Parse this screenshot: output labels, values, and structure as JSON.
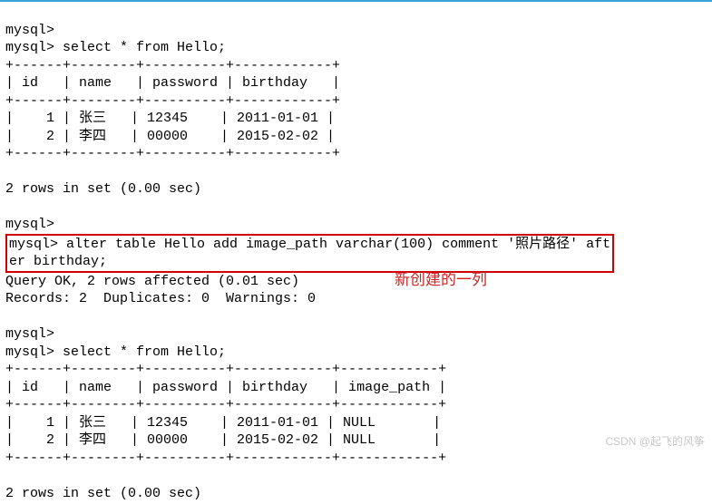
{
  "prompt": "mysql>",
  "query1": "select * from Hello;",
  "table1": {
    "border_top": "+------+--------+----------+------------+",
    "header": "| id   | name   | password | birthday   |",
    "border_mid": "+------+--------+----------+------------+",
    "rows": [
      "|    1 | 张三   | 12345    | 2011-01-01 |",
      "|    2 | 李四   | 00000    | 2015-02-02 |"
    ],
    "border_bot": "+------+--------+----------+------------+"
  },
  "result1": "2 rows in set (0.00 sec)",
  "alter_cmd_l1": "mysql> alter table Hello add image_path varchar(100) comment '照片路径' aft",
  "alter_cmd_l2": "er birthday;",
  "alter_result1": "Query OK, 2 rows affected (0.01 sec)",
  "alter_result2": "Records: 2  Duplicates: 0  Warnings: 0",
  "query2": "select * from Hello;",
  "table2": {
    "border_top": "+------+--------+----------+------------+------------+",
    "header": "| id   | name   | password | birthday   | image_path |",
    "border_mid": "+------+--------+----------+------------+------------+",
    "rows": [
      "|    1 | 张三   | 12345    | 2011-01-01 | NULL       |",
      "|    2 | 李四   | 00000    | 2015-02-02 | NULL       |"
    ],
    "border_bot": "+------+--------+----------+------------+------------+"
  },
  "result2": "2 rows in set (0.00 sec)",
  "annotation": "新创建的一列",
  "watermark": "CSDN @起飞的风筝"
}
